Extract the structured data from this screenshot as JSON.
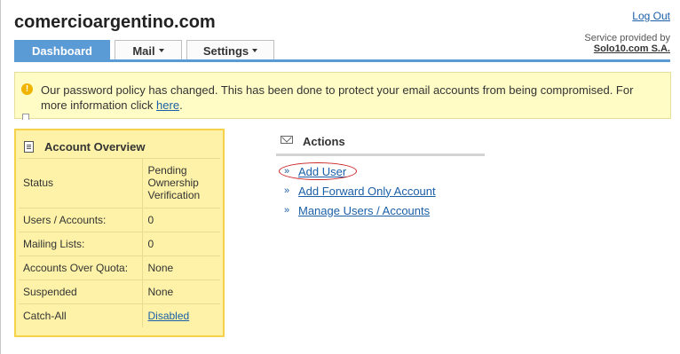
{
  "header": {
    "domain": "comercioargentino.com",
    "logout_label": "Log Out",
    "service_label": "Service provided by",
    "service_name": "Solo10.com S.A."
  },
  "tabs": [
    {
      "label": "Dashboard",
      "active": true,
      "has_menu": false
    },
    {
      "label": "Mail",
      "active": false,
      "has_menu": true
    },
    {
      "label": "Settings",
      "active": false,
      "has_menu": true
    }
  ],
  "notice": {
    "icon": "info-icon",
    "text": "Our password policy has changed. This has been done to protect your email accounts from being compromised. For more information click ",
    "link_label": "here",
    "suffix": "."
  },
  "overview": {
    "title": "Account Overview",
    "rows": [
      {
        "label": "Status",
        "value": "Pending Ownership Verification",
        "is_link": false
      },
      {
        "label": "Users / Accounts:",
        "value": "0",
        "is_link": false
      },
      {
        "label": "Mailing Lists:",
        "value": "0",
        "is_link": false
      },
      {
        "label": "Accounts Over Quota:",
        "value": "None",
        "is_link": false
      },
      {
        "label": "Suspended",
        "value": "None",
        "is_link": false
      },
      {
        "label": "Catch-All",
        "value": "Disabled",
        "is_link": true
      }
    ]
  },
  "actions": {
    "title": "Actions",
    "bullet": "»",
    "items": [
      {
        "label": "Add User"
      },
      {
        "label": "Add Forward Only Account"
      },
      {
        "label": "Manage Users / Accounts"
      }
    ]
  },
  "colors": {
    "accent": "#5b9bd5",
    "link": "#1a5fa8",
    "notice_bg": "#fffcc5",
    "overview_bg": "#fdf2a8",
    "overview_border": "#f5d24a",
    "highlight": "#cc2222"
  }
}
